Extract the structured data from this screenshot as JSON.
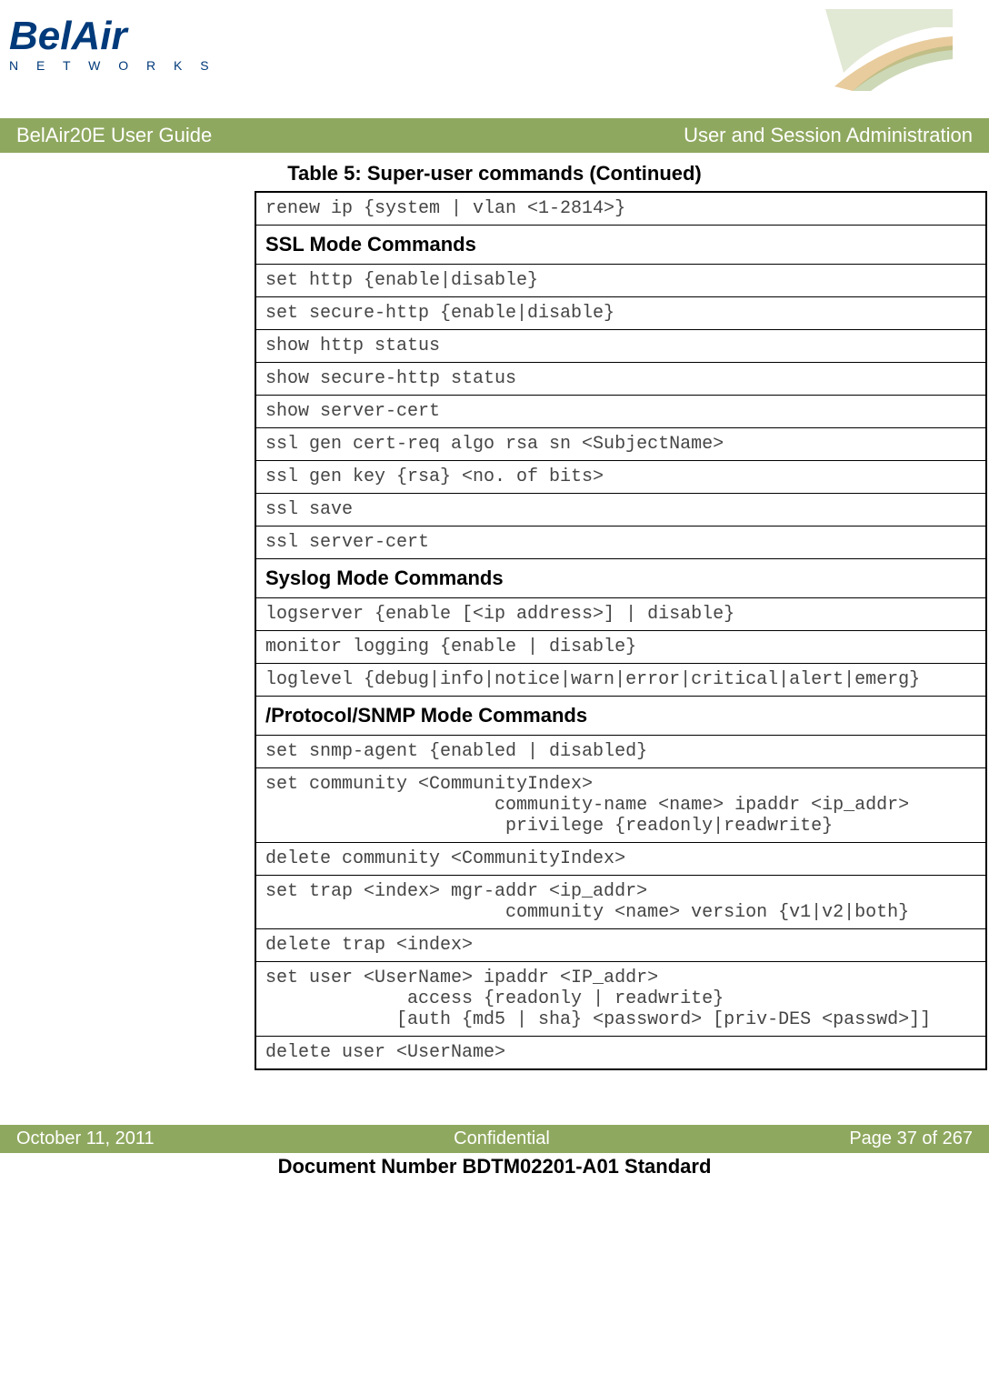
{
  "header": {
    "logo_main": "BelAir",
    "logo_sub": "N E T W O R K S",
    "banner_left": "BelAir20E User Guide",
    "banner_right": "User and Session Administration"
  },
  "table": {
    "caption": "Table 5: Super-user commands  (Continued)",
    "rows": [
      {
        "type": "cmd",
        "text": "renew ip {system | vlan <1-2814>}"
      },
      {
        "type": "section",
        "text": "SSL Mode Commands"
      },
      {
        "type": "cmd",
        "text": "set http {enable|disable}"
      },
      {
        "type": "cmd",
        "text": "set secure-http {enable|disable}"
      },
      {
        "type": "cmd",
        "text": "show http status"
      },
      {
        "type": "cmd",
        "text": "show secure-http status"
      },
      {
        "type": "cmd",
        "text": "show server-cert"
      },
      {
        "type": "cmd",
        "text": "ssl gen cert-req algo rsa sn <SubjectName>"
      },
      {
        "type": "cmd",
        "text": "ssl gen key {rsa} <no. of bits>"
      },
      {
        "type": "cmd",
        "text": "ssl save"
      },
      {
        "type": "cmd",
        "text": "ssl server-cert"
      },
      {
        "type": "section",
        "text": "Syslog Mode Commands"
      },
      {
        "type": "cmd",
        "text": "logserver {enable [<ip address>] | disable}"
      },
      {
        "type": "cmd",
        "text": "monitor logging {enable | disable}"
      },
      {
        "type": "cmd",
        "text": "loglevel {debug|info|notice|warn|error|critical|alert|emerg}"
      },
      {
        "type": "section",
        "text": "/Protocol/SNMP Mode Commands"
      },
      {
        "type": "cmd",
        "text": "set snmp-agent {enabled | disabled}"
      },
      {
        "type": "cmd",
        "text": "set community <CommunityIndex>\n                     community-name <name> ipaddr <ip_addr>\n                      privilege {readonly|readwrite}"
      },
      {
        "type": "cmd",
        "text": "delete community <CommunityIndex>"
      },
      {
        "type": "cmd",
        "text": "set trap <index> mgr-addr <ip_addr>\n                      community <name> version {v1|v2|both}"
      },
      {
        "type": "cmd",
        "text": "delete trap <index>"
      },
      {
        "type": "cmd",
        "text": "set user <UserName> ipaddr <IP_addr>\n             access {readonly | readwrite}\n            [auth {md5 | sha} <password> [priv-DES <passwd>]]"
      },
      {
        "type": "cmd",
        "text": "delete user <UserName>"
      }
    ]
  },
  "footer": {
    "left": "October 11, 2011",
    "center": "Confidential",
    "right": "Page 37 of 267",
    "docnum": "Document Number BDTM02201-A01 Standard"
  }
}
